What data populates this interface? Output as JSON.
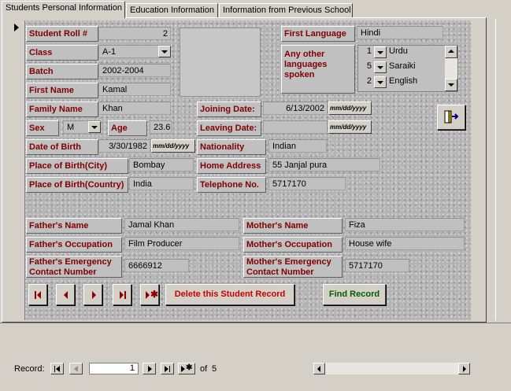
{
  "tabs": [
    {
      "label": "Students Personal Information"
    },
    {
      "label": "Education Information"
    },
    {
      "label": "Information from Previous School"
    }
  ],
  "student": {
    "roll_label": "Student Roll #",
    "roll_value": "2",
    "class_label": "Class",
    "class_value": "A-1",
    "batch_label": "Batch",
    "batch_value": "2002-2004",
    "first_name_label": "First Name",
    "first_name_value": "Kamal",
    "family_name_label": "Family Name",
    "family_name_value": "Khan",
    "sex_label": "Sex",
    "sex_value": "M",
    "age_label": "Age",
    "age_value": "23.6",
    "dob_label": "Date of Birth",
    "dob_value": "3/30/1982",
    "pob_city_label": "Place of Birth(City)",
    "pob_city_value": "Bombay",
    "pob_country_label": "Place of Birth(Country)",
    "pob_country_value": "India",
    "joining_label": "Joining Date:",
    "joining_value": "6/13/2002",
    "leaving_label": "Leaving Date:",
    "leaving_value": "",
    "nationality_label": "Nationality",
    "nationality_value": "Indian",
    "address_label": "Home Address",
    "address_value": "55 Janjal pura",
    "phone_label": "Telephone No.",
    "phone_value": "5717170",
    "date_format": "mm/dd/yyyy"
  },
  "languages": {
    "first_label": "First Language",
    "first_value": "Hindi",
    "other_label": "Any other languages spoken",
    "items": [
      {
        "num": "1",
        "name": "Urdu"
      },
      {
        "num": "5",
        "name": "Saraiki"
      },
      {
        "num": "2",
        "name": "English"
      }
    ]
  },
  "parents": {
    "father_name_label": "Father's Name",
    "father_name_value": "Jamal Khan",
    "father_occ_label": "Father's Occupation",
    "father_occ_value": "Film Producer",
    "father_emerg_label_1": "Father's Emergency",
    "father_emerg_label_2": "Contact Number",
    "father_emerg_value": "6666912",
    "mother_name_label": "Mother's Name",
    "mother_name_value": "Fiza",
    "mother_occ_label": "Mother's Occupation",
    "mother_occ_value": "House wife",
    "mother_emerg_label_1": "Mother's Emergency",
    "mother_emerg_label_2": "Contact Number",
    "mother_emerg_value": "5717170"
  },
  "actions": {
    "delete_label": "Delete this Student Record",
    "find_label": "Find Record",
    "exit_icon": "exit-door-icon"
  },
  "record_nav": {
    "label": "Record:",
    "current": "1",
    "of_label": "of",
    "total": "5"
  },
  "colors": {
    "label_text": "#800000",
    "delete_text": "#cc0000",
    "find_text": "#006000",
    "form_bg": "#b4b4b4"
  }
}
